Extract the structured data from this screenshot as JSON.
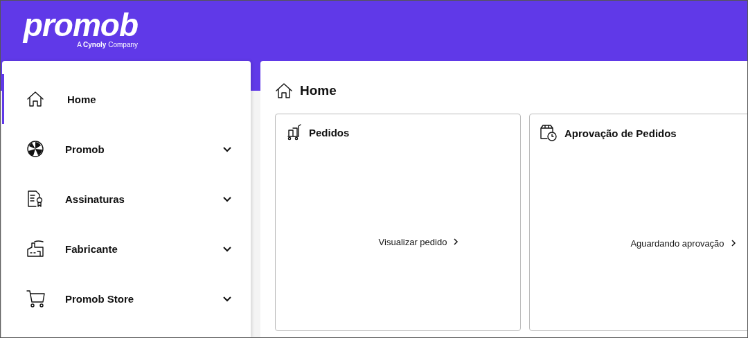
{
  "header": {
    "logo": "promob",
    "tagline": "A **Cynoly** Company"
  },
  "sidebar": {
    "items": [
      {
        "label": "Home",
        "kind": "link",
        "selected": true
      },
      {
        "label": "Promob",
        "kind": "group",
        "selected": false
      },
      {
        "label": "Assinaturas",
        "kind": "group",
        "selected": false
      },
      {
        "label": "Fabricante",
        "kind": "group",
        "selected": false
      },
      {
        "label": "Promob Store",
        "kind": "group",
        "selected": false
      }
    ]
  },
  "main": {
    "title": "Home",
    "cards": [
      {
        "title": "Pedidos",
        "link": "Visualizar pedido"
      },
      {
        "title": "Aprovação de Pedidos",
        "link": "Aguardando aprovação"
      }
    ]
  }
}
